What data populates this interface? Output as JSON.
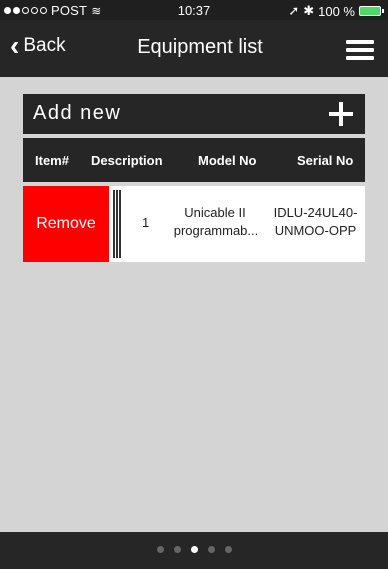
{
  "status_bar": {
    "carrier": "POST",
    "time": "10:37",
    "battery": "100 %",
    "signal_filled": 2,
    "signal_total": 5
  },
  "nav": {
    "back_label": "Back",
    "title": "Equipment list"
  },
  "add_new": {
    "label": "Add new"
  },
  "table": {
    "columns": [
      "Item#",
      "Description",
      "Model No",
      "Serial No"
    ],
    "rows": [
      {
        "item": "1",
        "model_line1": "Unicable II",
        "model_line2": "programmab...",
        "serial_line1": "IDLU-24UL40-",
        "serial_line2": "UNMOO-OPP",
        "action": "Remove"
      }
    ]
  },
  "pager": {
    "total": 5,
    "active_index": 2
  },
  "colors": {
    "bar": "#262626",
    "background": "#d4d4d4",
    "remove": "#ff0000",
    "battery": "#4cd964"
  }
}
